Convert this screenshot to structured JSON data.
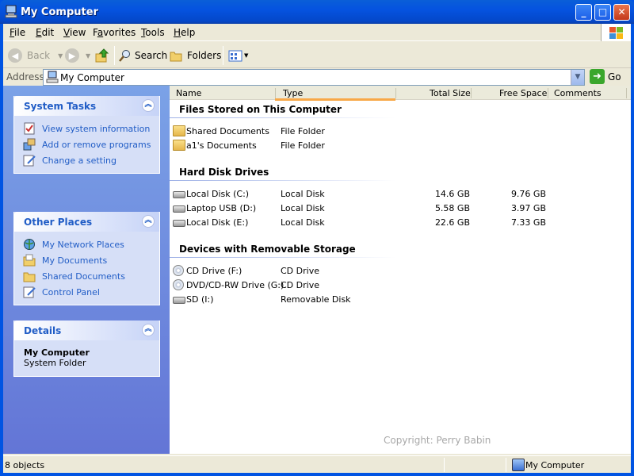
{
  "window": {
    "title": "My Computer"
  },
  "menu": {
    "items": [
      "File",
      "Edit",
      "View",
      "Favorites",
      "Tools",
      "Help"
    ],
    "underline": [
      "F",
      "E",
      "V",
      "a",
      "T",
      "H"
    ]
  },
  "toolbar": {
    "back": "Back",
    "search": "Search",
    "folders": "Folders"
  },
  "address": {
    "label": "Address",
    "value": "My Computer",
    "go": "Go"
  },
  "left": {
    "system_tasks": {
      "title": "System Tasks",
      "items": [
        "View system information",
        "Add or remove programs",
        "Change a setting"
      ]
    },
    "other_places": {
      "title": "Other Places",
      "items": [
        "My Network Places",
        "My Documents",
        "Shared Documents",
        "Control Panel"
      ]
    },
    "details": {
      "title": "Details",
      "name": "My Computer",
      "type": "System Folder"
    }
  },
  "columns": [
    "Name",
    "Type",
    "Total Size",
    "Free Space",
    "Comments"
  ],
  "groups": [
    {
      "title": "Files Stored on This Computer",
      "items": [
        {
          "name": "Shared Documents",
          "type": "File Folder",
          "total": "",
          "free": "",
          "icon": "folder-icon"
        },
        {
          "name": "a1's Documents",
          "type": "File Folder",
          "total": "",
          "free": "",
          "icon": "folder-icon"
        }
      ]
    },
    {
      "title": "Hard Disk Drives",
      "items": [
        {
          "name": "Local Disk (C:)",
          "type": "Local Disk",
          "total": "14.6 GB",
          "free": "9.76 GB",
          "icon": "hard-disk-icon"
        },
        {
          "name": "Laptop USB (D:)",
          "type": "Local Disk",
          "total": "5.58 GB",
          "free": "3.97 GB",
          "icon": "hard-disk-icon"
        },
        {
          "name": "Local Disk (E:)",
          "type": "Local Disk",
          "total": "22.6 GB",
          "free": "7.33 GB",
          "icon": "hard-disk-icon"
        }
      ]
    },
    {
      "title": "Devices with Removable Storage",
      "items": [
        {
          "name": "CD Drive (F:)",
          "type": "CD Drive",
          "total": "",
          "free": "",
          "icon": "cd-drive-icon"
        },
        {
          "name": "DVD/CD-RW Drive (G:)",
          "type": "CD Drive",
          "total": "",
          "free": "",
          "icon": "cd-drive-icon"
        },
        {
          "name": "SD (I:)",
          "type": "Removable Disk",
          "total": "",
          "free": "",
          "icon": "removable-disk-icon"
        }
      ]
    }
  ],
  "watermark": "Copyright: Perry Babin",
  "status": {
    "count": "8 objects",
    "location": "My Computer"
  }
}
